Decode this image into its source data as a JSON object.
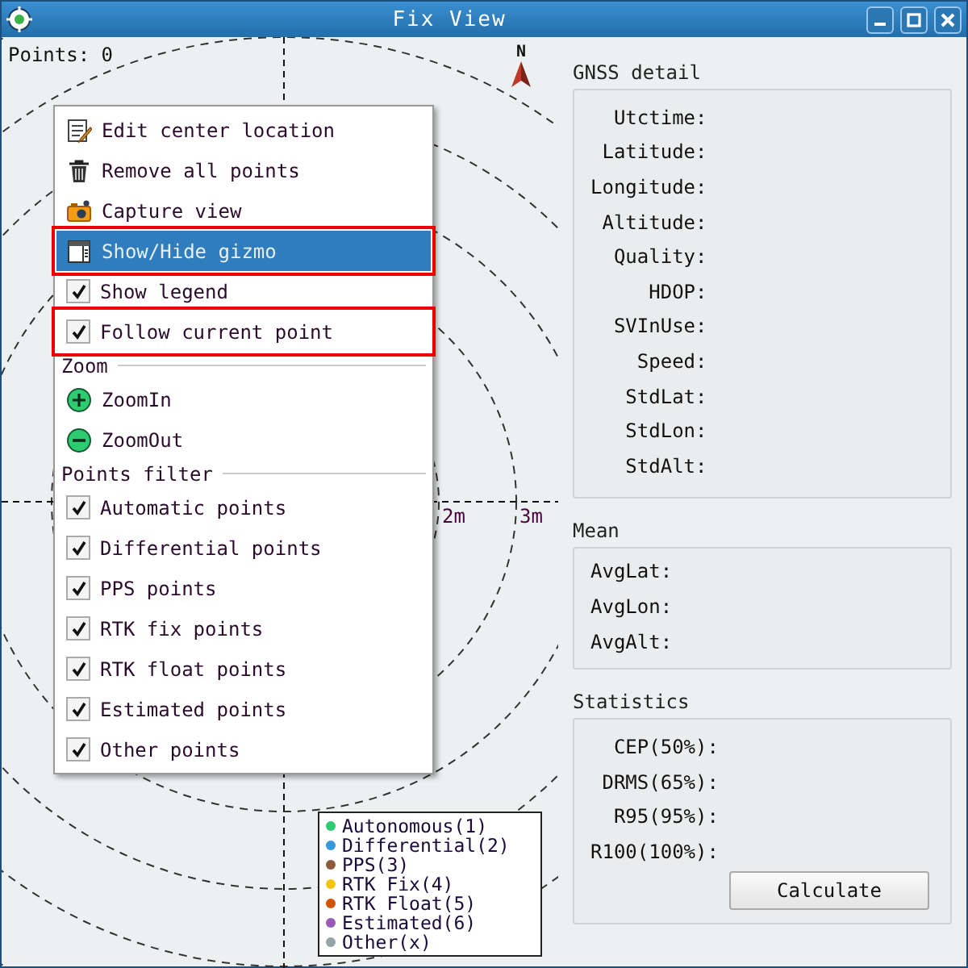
{
  "window": {
    "title": "Fix View"
  },
  "plot": {
    "points_label": "Points: 0",
    "north_label": "N",
    "ring_labels": [
      "2m",
      "3m"
    ]
  },
  "context_menu": {
    "items": [
      {
        "kind": "action",
        "label": "Edit center location",
        "selected": false,
        "highlighted": false
      },
      {
        "kind": "action",
        "label": "Remove all points",
        "selected": false,
        "highlighted": false
      },
      {
        "kind": "action",
        "label": "Capture view",
        "selected": false,
        "highlighted": false
      },
      {
        "kind": "action",
        "label": "Show/Hide gizmo",
        "selected": true,
        "highlighted": true
      },
      {
        "kind": "check",
        "label": "Show legend",
        "checked": true,
        "selected": false,
        "highlighted": false
      },
      {
        "kind": "check",
        "label": "Follow current point",
        "checked": true,
        "selected": false,
        "highlighted": true
      },
      {
        "kind": "section",
        "label": "Zoom"
      },
      {
        "kind": "action",
        "label": "ZoomIn",
        "selected": false,
        "highlighted": false
      },
      {
        "kind": "action",
        "label": "ZoomOut",
        "selected": false,
        "highlighted": false
      },
      {
        "kind": "section",
        "label": "Points filter"
      },
      {
        "kind": "check",
        "label": "Automatic points",
        "checked": true,
        "selected": false,
        "highlighted": false
      },
      {
        "kind": "check",
        "label": "Differential points",
        "checked": true,
        "selected": false,
        "highlighted": false
      },
      {
        "kind": "check",
        "label": "PPS points",
        "checked": true,
        "selected": false,
        "highlighted": false
      },
      {
        "kind": "check",
        "label": "RTK fix points",
        "checked": true,
        "selected": false,
        "highlighted": false
      },
      {
        "kind": "check",
        "label": "RTK float points",
        "checked": true,
        "selected": false,
        "highlighted": false
      },
      {
        "kind": "check",
        "label": "Estimated points",
        "checked": true,
        "selected": false,
        "highlighted": false
      },
      {
        "kind": "check",
        "label": "Other points",
        "checked": true,
        "selected": false,
        "highlighted": false
      }
    ]
  },
  "legend": [
    {
      "label": "Autonomous(1)",
      "color": "#2ecc71"
    },
    {
      "label": "Differential(2)",
      "color": "#3498db"
    },
    {
      "label": "PPS(3)",
      "color": "#8e5a3c"
    },
    {
      "label": "RTK Fix(4)",
      "color": "#f1c40f"
    },
    {
      "label": "RTK Float(5)",
      "color": "#d35400"
    },
    {
      "label": "Estimated(6)",
      "color": "#9b59b6"
    },
    {
      "label": "Other(x)",
      "color": "#95a5a6"
    }
  ],
  "groups": [
    {
      "title": "GNSS detail",
      "fields": [
        "Utctime:",
        "Latitude:",
        "Longitude:",
        "Altitude:",
        "Quality:",
        "HDOP:",
        "SVInUse:",
        "Speed:",
        "StdLat:",
        "StdLon:",
        "StdAlt:"
      ]
    },
    {
      "title": "Mean",
      "fields": [
        "AvgLat:",
        "AvgLon:",
        "AvgAlt:"
      ]
    },
    {
      "title": "Statistics",
      "fields": [
        "CEP(50%):",
        "DRMS(65%):",
        "R95(95%):",
        "R100(100%):"
      ],
      "button": "Calculate"
    }
  ]
}
